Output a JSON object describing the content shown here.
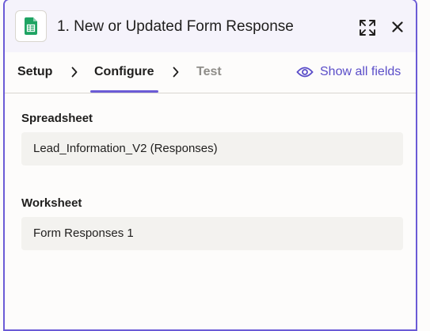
{
  "header": {
    "title": "1. New or Updated Form Response",
    "app_icon": "google-sheets-icon",
    "expand_icon": "expand-icon",
    "close_icon": "close-icon"
  },
  "tabs": [
    {
      "label": "Setup",
      "state": "done"
    },
    {
      "label": "Configure",
      "state": "active"
    },
    {
      "label": "Test",
      "state": "pending"
    }
  ],
  "show_all_fields": {
    "label": "Show all fields",
    "icon": "eye-icon"
  },
  "fields": {
    "spreadsheet": {
      "label": "Spreadsheet",
      "value": "Lead_Information_V2 (Responses)"
    },
    "worksheet": {
      "label": "Worksheet",
      "value": "Form Responses 1"
    }
  },
  "colors": {
    "accent": "#6b5bd6",
    "link": "#5b4ec9",
    "sheets_green": "#1fa463",
    "header_bg": "#f5f3fb",
    "field_bg": "#f3f2ef"
  }
}
